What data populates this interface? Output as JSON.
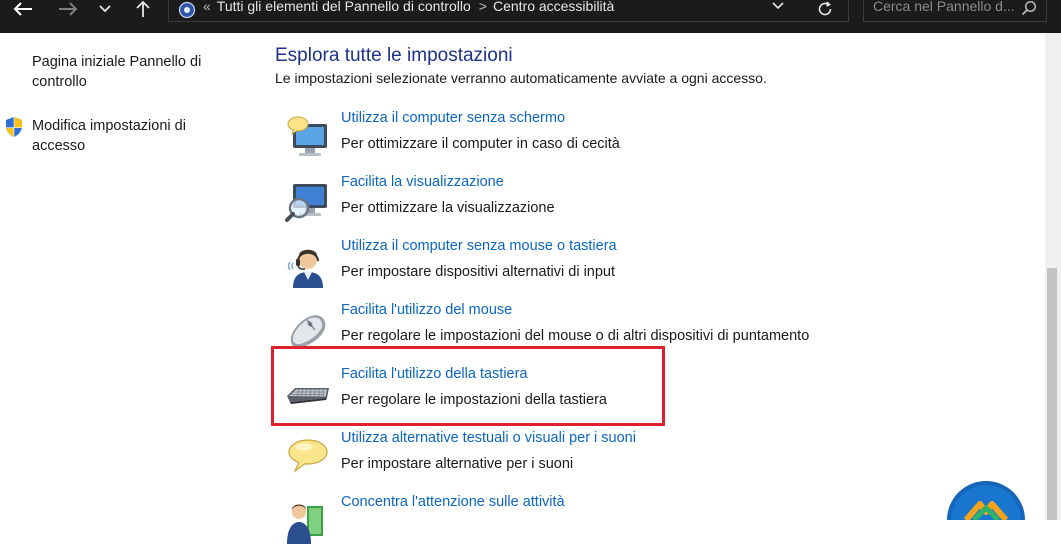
{
  "address_bar": {
    "breadcrumbs": [
      "Tutti gli elementi del Pannello di controllo",
      "Centro accessibilità"
    ],
    "search_placeholder": "Cerca nel Pannello d..."
  },
  "left_pane": {
    "links": [
      {
        "label": "Pagina iniziale Pannello di controllo"
      },
      {
        "label": "Modifica impostazioni di accesso",
        "icon": "uac-shield-icon"
      }
    ]
  },
  "main": {
    "heading": "Esplora tutte le impostazioni",
    "subheading": "Le impostazioni selezionate verranno automaticamente avviate a ogni accesso.",
    "options": [
      {
        "icon": "monitor-speech-icon",
        "link": "Utilizza il computer senza schermo",
        "desc": "Per ottimizzare il computer in caso di cecità"
      },
      {
        "icon": "monitor-magnifier-icon",
        "link": "Facilita la visualizzazione",
        "desc": "Per ottimizzare la visualizzazione"
      },
      {
        "icon": "person-headset-icon",
        "link": "Utilizza il computer senza mouse o tastiera",
        "desc": "Per impostare dispositivi alternativi di input"
      },
      {
        "icon": "mouse-icon",
        "link": "Facilita l'utilizzo del mouse",
        "desc": "Per regolare le impostazioni del mouse o di altri dispositivi di puntamento"
      },
      {
        "icon": "keyboard-icon",
        "link": "Facilita l'utilizzo della tastiera",
        "desc": "Per regolare le impostazioni della tastiera"
      },
      {
        "icon": "speech-bubble-icon",
        "link": "Utilizza alternative testuali o visuali per i suoni",
        "desc": "Per impostare alternative per i suoni"
      },
      {
        "icon": "person-book-icon",
        "link": "Concentra l'attenzione sulle attività",
        "desc": ""
      }
    ]
  },
  "colors": {
    "link": "#0b66c2",
    "heading": "#1e3287",
    "highlight_border": "#e0202e",
    "titlebar": "#1b1b1b"
  }
}
